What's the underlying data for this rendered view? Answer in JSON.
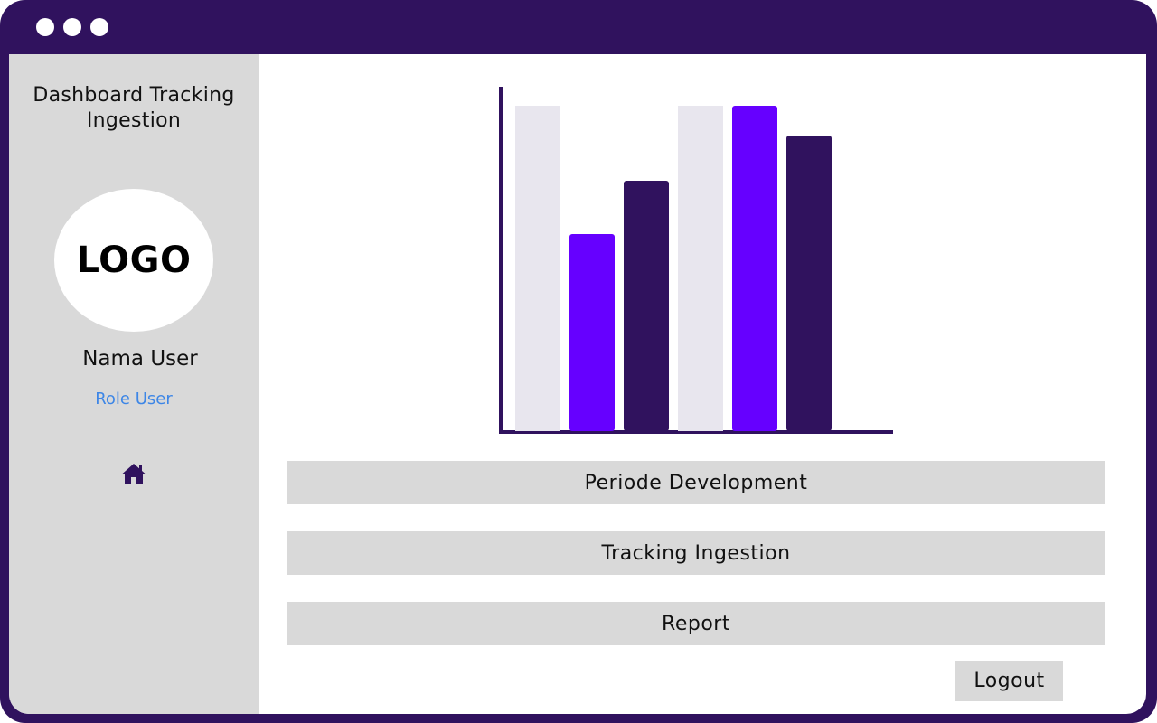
{
  "window": {
    "frame_color": "#30125e"
  },
  "sidebar": {
    "title": "Dashboard Tracking\nIngestion",
    "logo_text": "LOGO",
    "user_name": "Nama User",
    "user_role": "Role User",
    "home_icon": "home-icon"
  },
  "chart_data": {
    "type": "bar",
    "title": "",
    "xlabel": "",
    "ylabel": "",
    "ylim": [
      0,
      380
    ],
    "grid": false,
    "series_colors": [
      "#e8e6ee",
      "#6600ff",
      "#30125e"
    ],
    "groups": [
      {
        "values": [
          360,
          218,
          277
        ]
      },
      {
        "values": [
          360,
          360,
          327
        ]
      }
    ]
  },
  "menu": {
    "items": [
      {
        "label": "Periode Development"
      },
      {
        "label": "Tracking Ingestion"
      },
      {
        "label": "Report"
      }
    ],
    "logout_label": "Logout"
  }
}
